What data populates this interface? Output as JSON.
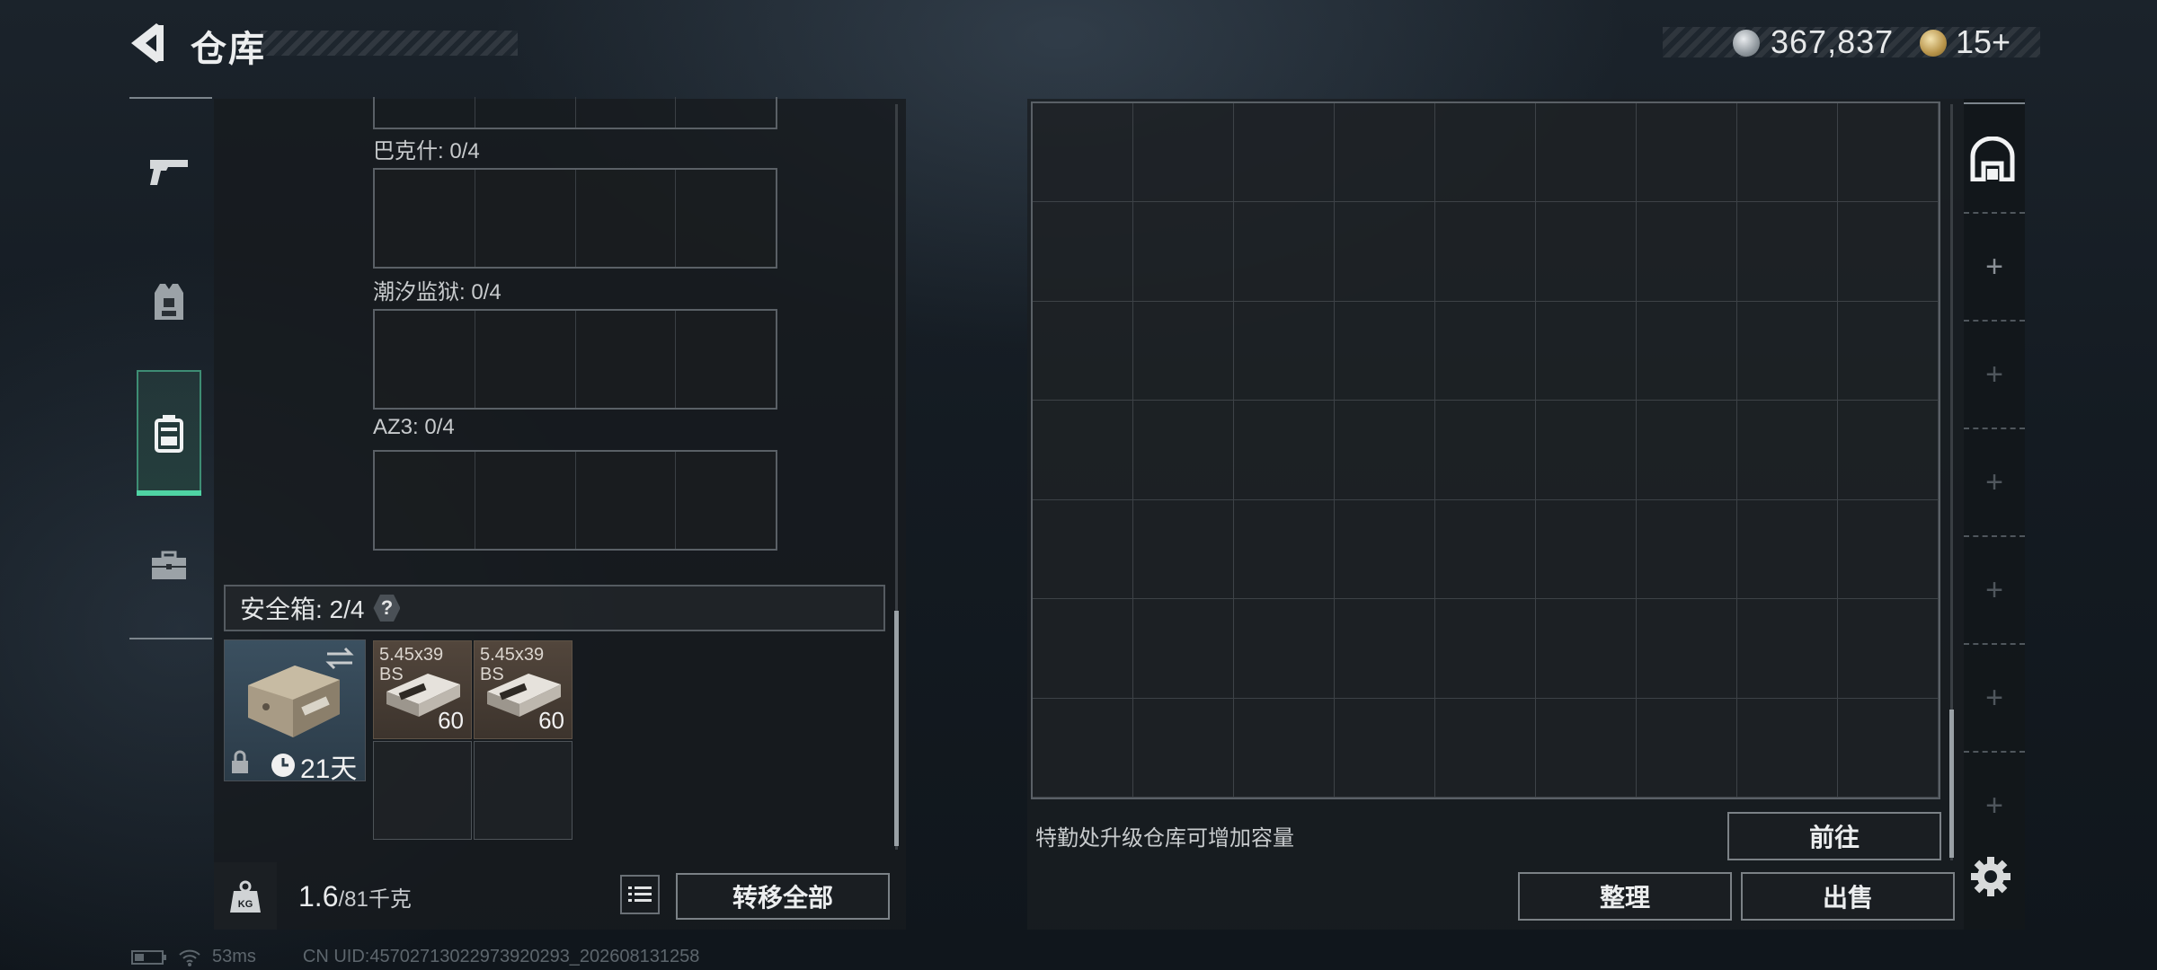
{
  "header": {
    "title": "仓库",
    "currency": "367,837",
    "tickets": "15+"
  },
  "sidebar": {
    "items": [
      {
        "name": "weapons",
        "icon": "pistol-icon"
      },
      {
        "name": "gear",
        "icon": "vest-icon"
      },
      {
        "name": "backpack",
        "icon": "backpack-icon",
        "active": true
      },
      {
        "name": "case",
        "icon": "briefcase-icon"
      }
    ]
  },
  "left_panel": {
    "containers": [
      {
        "label": "巴克什: 0/4"
      },
      {
        "label": "潮汐监狱: 0/4"
      },
      {
        "label": "AZ3: 0/4"
      }
    ],
    "safe_box": {
      "label": "安全箱: 2/4",
      "help": "?",
      "days": "21天",
      "items": [
        {
          "name": "5.45x39\nBS",
          "qty": "60"
        },
        {
          "name": "5.45x39\nBS",
          "qty": "60"
        }
      ]
    },
    "weight_main": "1.6",
    "weight_rest": "/81千克",
    "weight_icon_text": "KG",
    "transfer_all": "转移全部"
  },
  "right_panel": {
    "upgrade_hint": "特勤处升级仓库可增加容量",
    "goto": "前往",
    "sort": "整理",
    "sell": "出售"
  },
  "status_bar": {
    "ping": "53ms",
    "uid": "CN UID:45702713022973920293_202608131258"
  },
  "colors": {
    "accent": "#4fd3a3",
    "panel_bg": "#171b1f",
    "ammo_bg": "#4a3f36"
  }
}
